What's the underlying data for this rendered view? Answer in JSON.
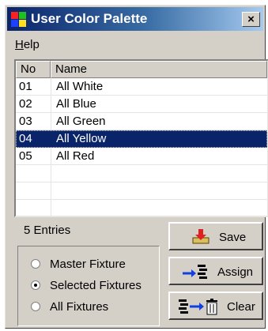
{
  "window": {
    "title": "User Color Palette",
    "close_glyph": "×"
  },
  "menu": {
    "help": "Help"
  },
  "list": {
    "columns": [
      "No",
      "Name"
    ],
    "rows": [
      {
        "no": "01",
        "name": "All White"
      },
      {
        "no": "02",
        "name": "All Blue"
      },
      {
        "no": "03",
        "name": "All Green"
      },
      {
        "no": "04",
        "name": "All Yellow",
        "selected": true
      },
      {
        "no": "05",
        "name": "All Red"
      }
    ]
  },
  "status": {
    "entries": "5 Entries"
  },
  "scope": {
    "options": [
      "Master Fixture",
      "Selected Fixtures",
      "All Fixtures"
    ],
    "selected": "Selected Fixtures"
  },
  "buttons": {
    "save": "Save",
    "assign": "Assign",
    "clear": "Clear"
  },
  "icons": {
    "app": "palette-icon",
    "save": "save-icon",
    "assign": "assign-arrow-icon",
    "clear": "clear-trash-icon"
  },
  "colors": {
    "title_start": "#0a246a",
    "title_end": "#a6caf0",
    "selection": "#0a246a",
    "face": "#d4d0c8"
  }
}
